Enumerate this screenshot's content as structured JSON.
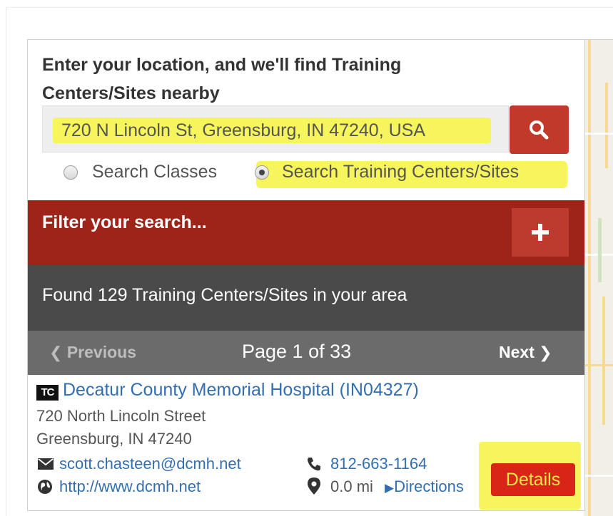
{
  "search": {
    "heading_line1": "Enter your location, and we'll find Training",
    "heading_line2": "Centers/Sites nearby",
    "location_value": "720 N Lincoln St, Greensburg, IN 47240, USA",
    "search_button_icon": "search-icon",
    "options": [
      {
        "label": "Search Classes",
        "selected": false
      },
      {
        "label": "Search Training Centers/Sites",
        "selected": true
      }
    ]
  },
  "filter": {
    "title": "Filter your search...",
    "toggle_icon": "plus-icon"
  },
  "results_summary": "Found 129 Training Centers/Sites in your area",
  "pagination": {
    "previous_label": "Previous",
    "page_label": "Page 1 of 33",
    "next_label": "Next"
  },
  "result": {
    "badge": "TC",
    "name": "Decatur County Memorial Hospital (IN04327)",
    "address_line1": "720 North Lincoln Street",
    "address_line2": "Greensburg, IN 47240",
    "email": "scott.chasteen@dcmh.net",
    "phone": "812-663-1164",
    "website": "http://www.dcmh.net",
    "distance": "0.0 mi",
    "directions_label": "Directions",
    "details_label": "Details"
  },
  "colors": {
    "accent_red": "#c0392b",
    "filter_bar": "#9e2419",
    "highlight": "#f6f55c",
    "link_blue": "#336fb0"
  }
}
